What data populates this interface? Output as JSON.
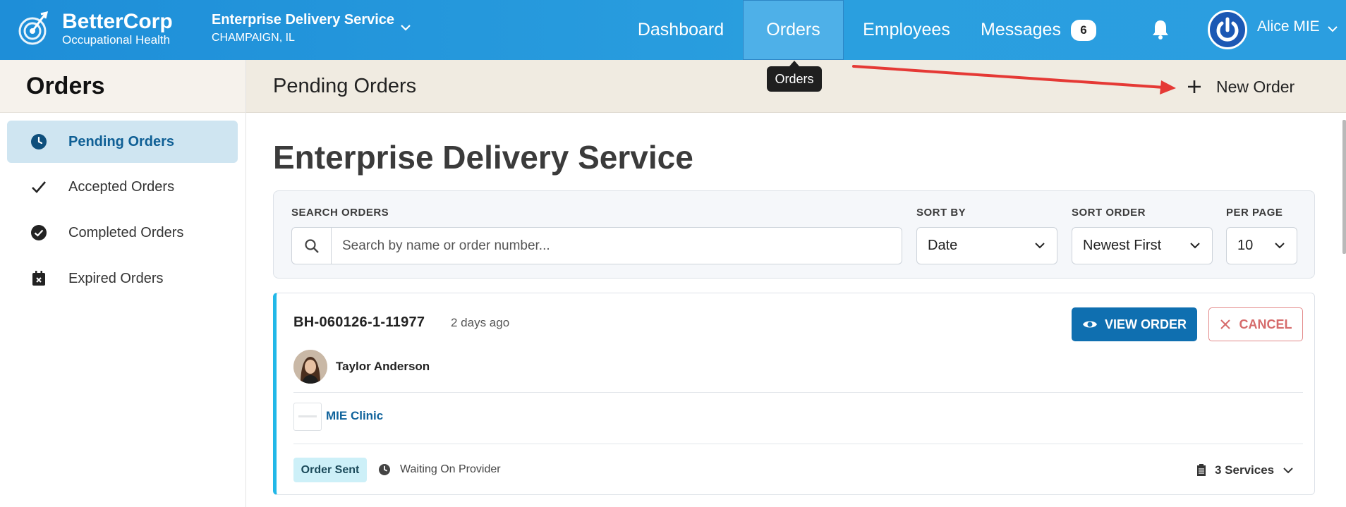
{
  "header": {
    "brand_name": "BetterCorp",
    "brand_sub": "Occupational Health",
    "org_name": "Enterprise Delivery Service",
    "org_location": "CHAMPAIGN, IL",
    "nav": {
      "dashboard": "Dashboard",
      "orders": "Orders",
      "employees": "Employees",
      "messages": "Messages",
      "messages_count": "6"
    },
    "user_name": "Alice MIE",
    "tooltip": "Orders"
  },
  "sidebar": {
    "title": "Orders",
    "items": [
      {
        "label": "Pending Orders",
        "icon": "clock-icon",
        "active": true
      },
      {
        "label": "Accepted Orders",
        "icon": "check-icon",
        "active": false
      },
      {
        "label": "Completed Orders",
        "icon": "check-circle-icon",
        "active": false
      },
      {
        "label": "Expired Orders",
        "icon": "calendar-x-icon",
        "active": false
      }
    ]
  },
  "content": {
    "header_title": "Pending Orders",
    "new_order_label": "New Order",
    "page_title": "Enterprise Delivery Service"
  },
  "filters": {
    "search_label": "SEARCH ORDERS",
    "search_placeholder": "Search by name or order number...",
    "sort_by_label": "SORT BY",
    "sort_by_value": "Date",
    "sort_order_label": "SORT ORDER",
    "sort_order_value": "Newest First",
    "per_page_label": "PER PAGE",
    "per_page_value": "10"
  },
  "order": {
    "number": "BH-060126-1-11977",
    "age": "2 days ago",
    "view_label": "VIEW ORDER",
    "cancel_label": "CANCEL",
    "person": "Taylor Anderson",
    "clinic": "MIE Clinic",
    "status": "Order Sent",
    "wait_status": "Waiting On Provider",
    "services": "3 Services"
  },
  "colors": {
    "topbar": "#2a9fdf",
    "accent": "#0f6fb0",
    "active_bg": "#cfe5f1",
    "cancel": "#d66b6b",
    "card_accent": "#22b8e8"
  }
}
